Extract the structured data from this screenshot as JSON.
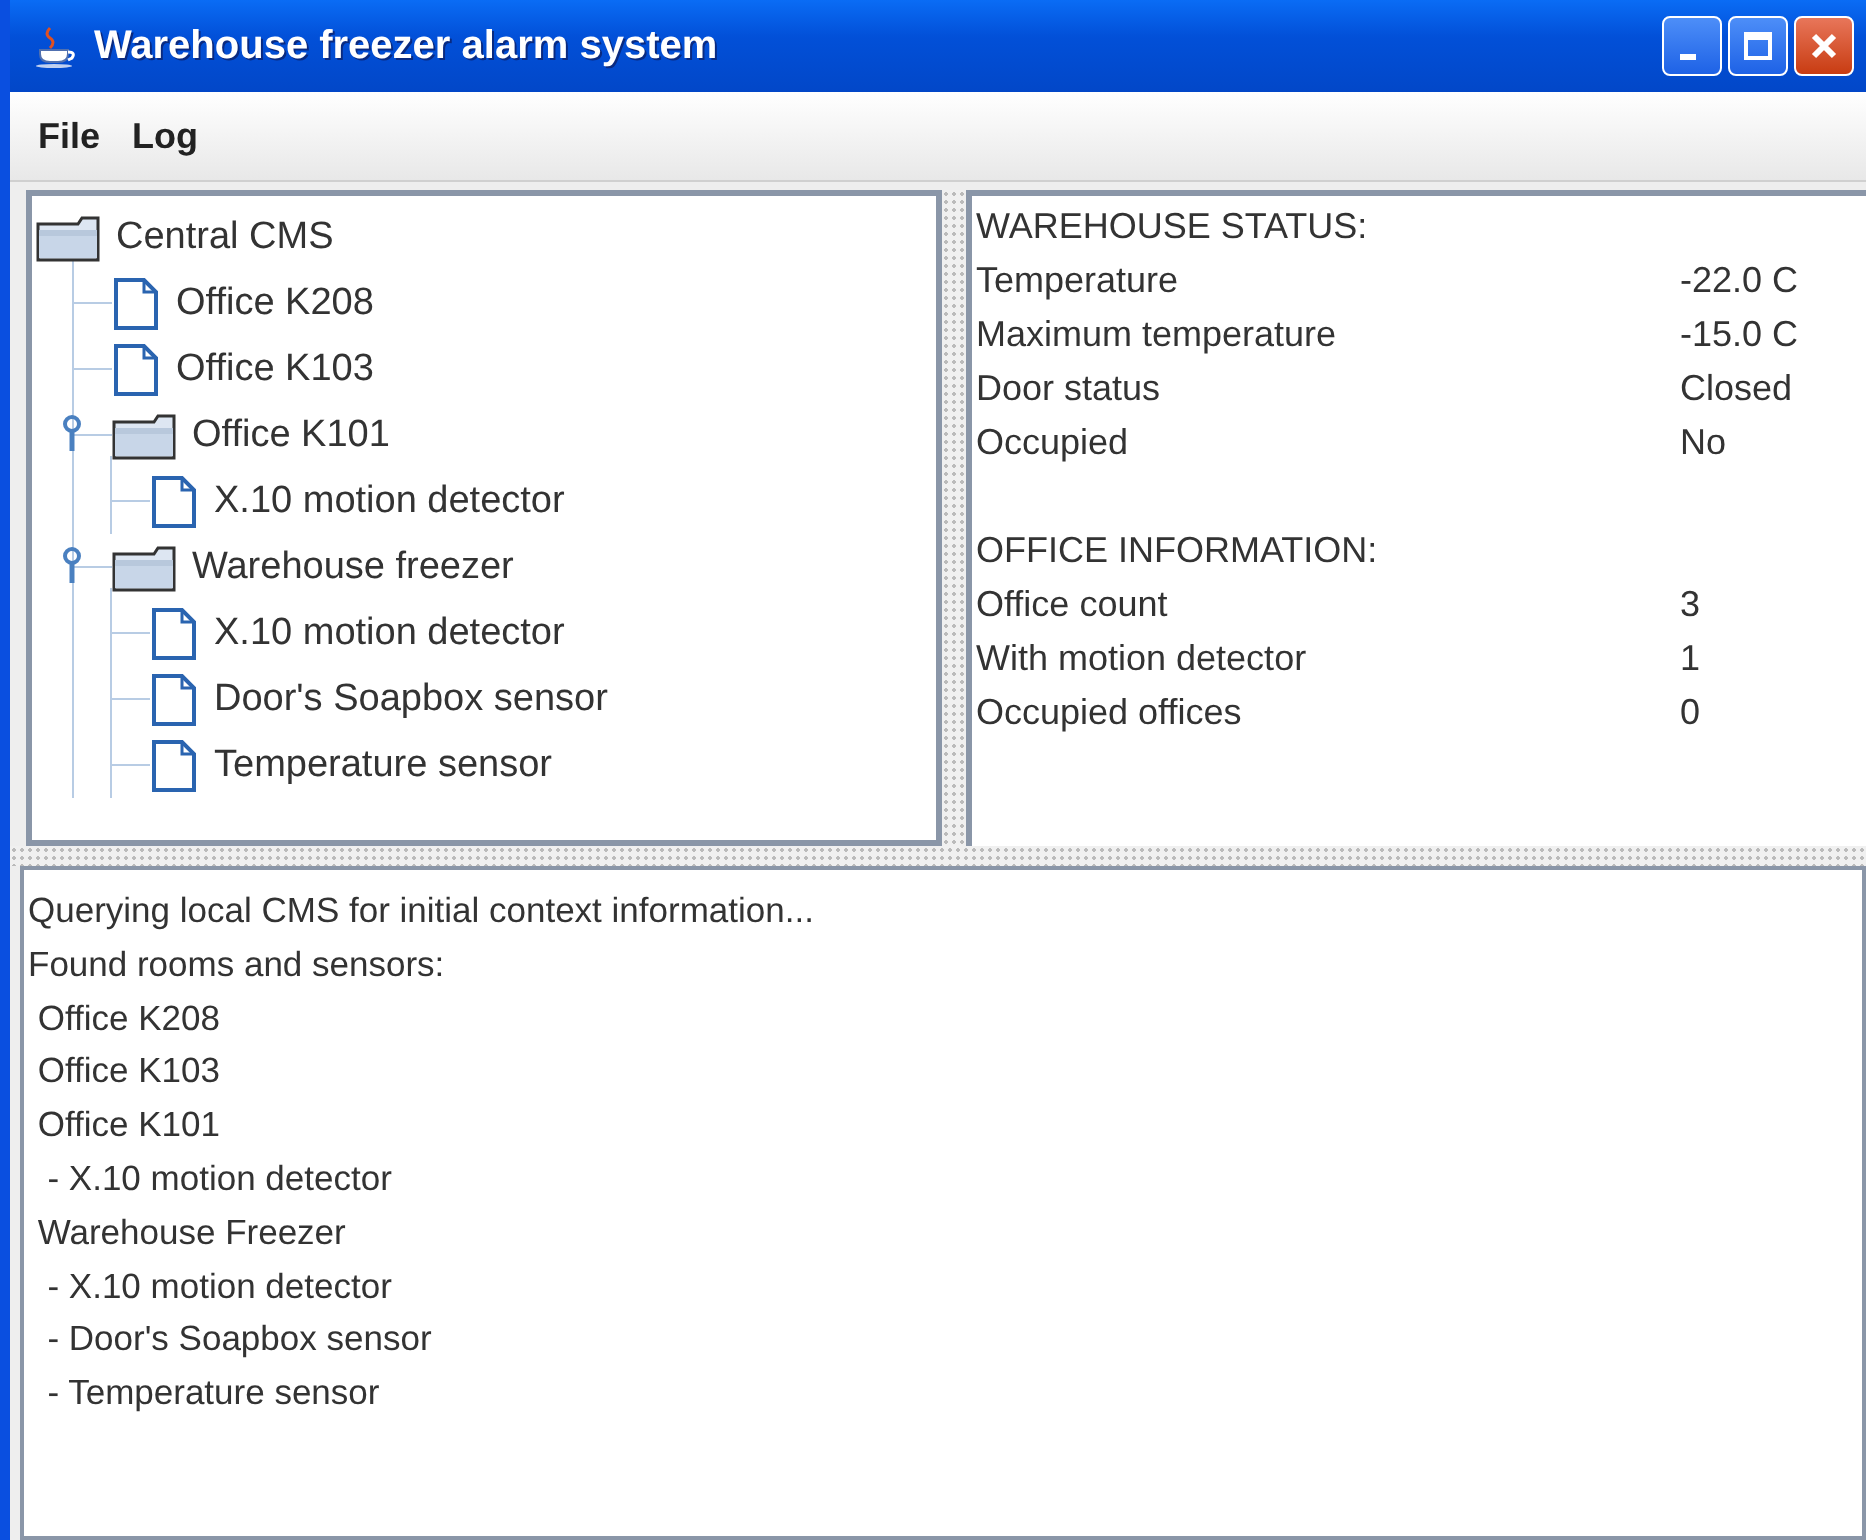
{
  "window": {
    "title": "Warehouse freezer alarm system"
  },
  "menu": [
    "File",
    "Log"
  ],
  "tree": {
    "label": "Central CMS",
    "kind": "folder",
    "children": [
      {
        "label": "Office K208",
        "kind": "file"
      },
      {
        "label": "Office K103",
        "kind": "file"
      },
      {
        "label": "Office K101",
        "kind": "folder",
        "expanded": true,
        "children": [
          {
            "label": "X.10 motion detector",
            "kind": "file"
          }
        ]
      },
      {
        "label": "Warehouse freezer",
        "kind": "folder",
        "expanded": true,
        "children": [
          {
            "label": "X.10 motion detector",
            "kind": "file"
          },
          {
            "label": "Door's Soapbox sensor",
            "kind": "file"
          },
          {
            "label": "Temperature sensor",
            "kind": "file"
          }
        ]
      }
    ]
  },
  "status_sections": [
    {
      "heading": "WAREHOUSE STATUS:",
      "rows": [
        {
          "label": "Temperature",
          "value": "-22.0 C"
        },
        {
          "label": "Maximum temperature",
          "value": "-15.0 C"
        },
        {
          "label": "Door status",
          "value": "Closed"
        },
        {
          "label": "Occupied",
          "value": "No"
        }
      ]
    },
    {
      "heading": "OFFICE INFORMATION:",
      "rows": [
        {
          "label": "Office count",
          "value": "3"
        },
        {
          "label": "With motion detector",
          "value": "1"
        },
        {
          "label": "Occupied offices",
          "value": "0"
        }
      ]
    }
  ],
  "log": [
    "Querying local CMS for initial context information...",
    "Found rooms and sensors:",
    " Office K208",
    " Office K103",
    " Office K101",
    "  - X.10 motion detector",
    " Warehouse Freezer",
    "  - X.10 motion detector",
    "  - Door's Soapbox sensor",
    "  - Temperature sensor"
  ]
}
